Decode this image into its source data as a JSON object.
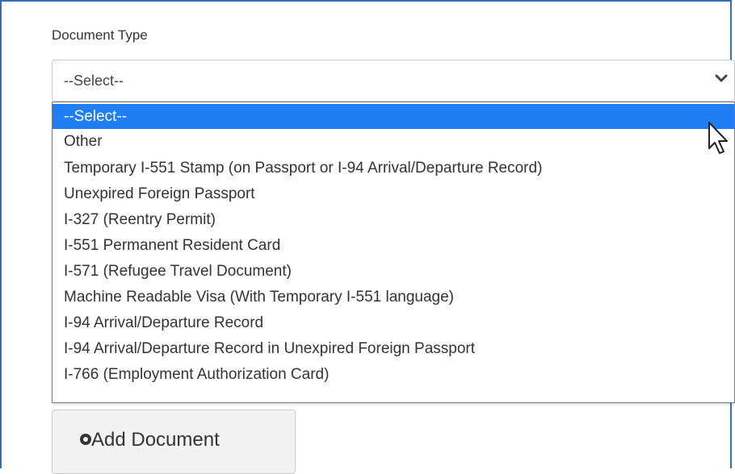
{
  "form": {
    "label": "Document Type",
    "select": {
      "current_value": "--Select--"
    },
    "add_button_label": "Add Document"
  },
  "dropdown": {
    "options": [
      {
        "label": "--Select--",
        "selected": true
      },
      {
        "label": "Other",
        "selected": false
      },
      {
        "label": "Temporary I-551 Stamp (on Passport or I-94 Arrival/Departure Record)",
        "selected": false
      },
      {
        "label": "Unexpired Foreign Passport",
        "selected": false
      },
      {
        "label": "I-327 (Reentry Permit)",
        "selected": false
      },
      {
        "label": "I-551 Permanent Resident Card",
        "selected": false
      },
      {
        "label": "I-571 (Refugee Travel Document)",
        "selected": false
      },
      {
        "label": "Machine Readable Visa (With Temporary I-551 language)",
        "selected": false
      },
      {
        "label": "I-94 Arrival/Departure Record",
        "selected": false
      },
      {
        "label": "I-94 Arrival/Departure Record in Unexpired Foreign Passport",
        "selected": false
      },
      {
        "label": "I-766 (Employment Authorization Card)",
        "selected": false
      }
    ]
  },
  "icons": {
    "select_chevron": "chevron-down-icon",
    "pointer": "mouse-cursor-icon",
    "add": "circle-plus-icon"
  },
  "colors": {
    "highlight": "#1f7ef3",
    "frame_border": "#2f6fb7",
    "text": "#333333"
  }
}
